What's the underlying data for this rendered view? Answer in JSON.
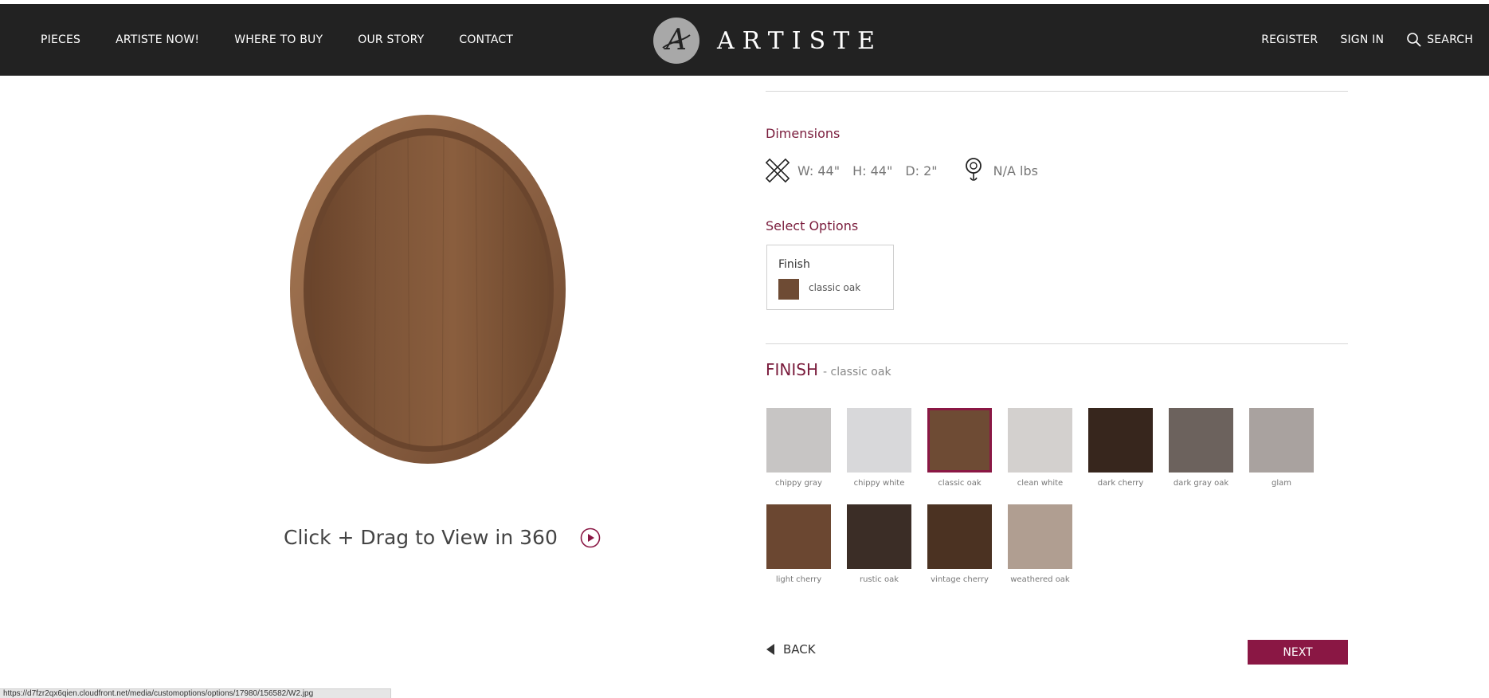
{
  "header": {
    "nav_left": [
      "PIECES",
      "ARTISTE NOW!",
      "WHERE TO BUY",
      "OUR STORY",
      "CONTACT"
    ],
    "logo_text": "ARTISTE",
    "nav_right": {
      "register": "REGISTER",
      "sign_in": "SIGN IN",
      "search": "SEARCH"
    }
  },
  "product": {
    "view360_label": "Click + Drag to View in 360"
  },
  "dimensions": {
    "title": "Dimensions",
    "width": "W: 44\"",
    "height": "H: 44\"",
    "depth": "D: 2\"",
    "weight": "N/A lbs"
  },
  "options": {
    "title": "Select Options",
    "finish_label": "Finish",
    "finish_value": "classic oak"
  },
  "finish_picker": {
    "heading": "FINISH",
    "subheading": "- classic oak",
    "selected": "classic oak",
    "swatches": [
      {
        "name": "chippy gray",
        "color": "#c7c5c4"
      },
      {
        "name": "chippy white",
        "color": "#d8d8da"
      },
      {
        "name": "classic oak",
        "color": "#6e4b34"
      },
      {
        "name": "clean white",
        "color": "#d3d0ce"
      },
      {
        "name": "dark cherry",
        "color": "#37261d"
      },
      {
        "name": "dark gray oak",
        "color": "#6c625d"
      },
      {
        "name": "glam",
        "color": "#a9a29f"
      },
      {
        "name": "light cherry",
        "color": "#6b4731"
      },
      {
        "name": "rustic oak",
        "color": "#3b2d26"
      },
      {
        "name": "vintage cherry",
        "color": "#4b3222"
      },
      {
        "name": "weathered oak",
        "color": "#b09e91"
      }
    ]
  },
  "footer": {
    "back": "BACK",
    "next": "NEXT"
  },
  "status_url": "https://d7fzr2qx6qien.cloudfront.net/media/customoptions/options/17980/156582/W2.jpg",
  "colors": {
    "accent": "#8a1744",
    "header_bg": "#222222",
    "wood": "#7a5236"
  }
}
